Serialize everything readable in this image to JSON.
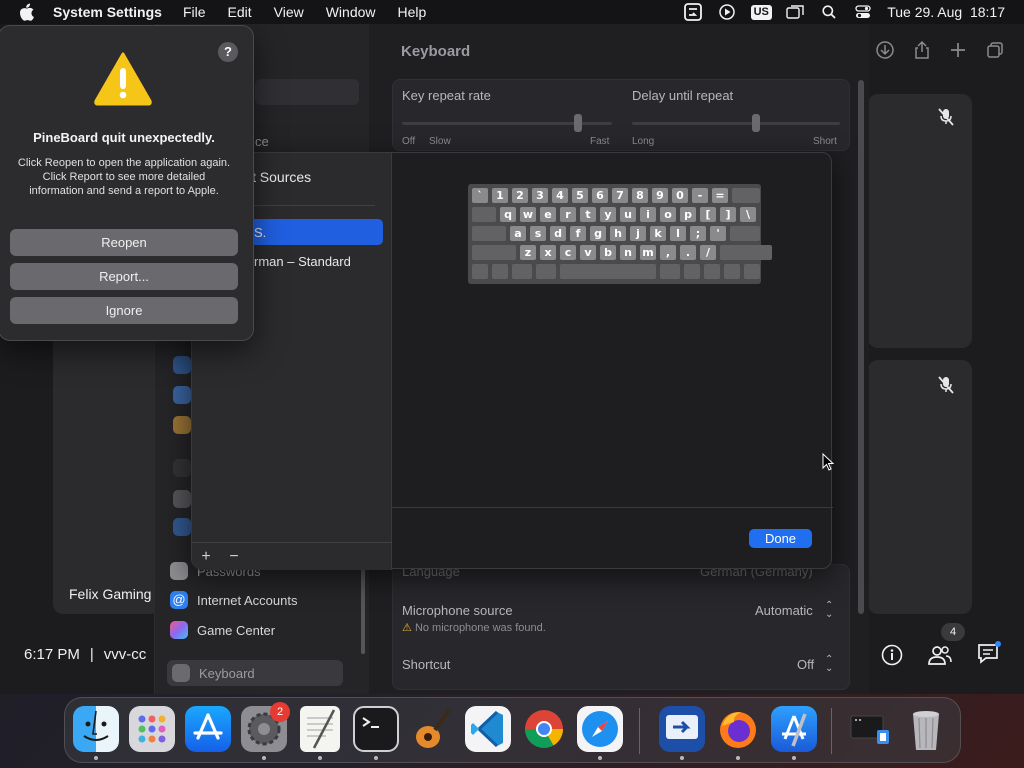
{
  "menubar": {
    "app_name": "System Settings",
    "menus": [
      "File",
      "Edit",
      "View",
      "Window",
      "Help"
    ],
    "input_source": "US",
    "datetime": "Tue 29. Aug  18:17"
  },
  "crash_dialog": {
    "title": "PineBoard quit unexpectedly.",
    "message": "Click Reopen to open the application again. Click Report to see more detailed information and send a report to Apple.",
    "help": "?",
    "buttons": {
      "reopen": "Reopen",
      "report": "Report...",
      "ignore": "Ignore"
    }
  },
  "settings": {
    "page_title": "Keyboard",
    "key_repeat": {
      "label": "Key repeat rate",
      "min": "Off",
      "min2": "Slow",
      "max": "Fast",
      "value": 0.95
    },
    "delay_repeat": {
      "label": "Delay until repeat",
      "min": "Long",
      "max": "Short",
      "value": 0.63
    },
    "sidebar_fragment": "ce",
    "sidebar_items": [
      {
        "label": "Passwords"
      },
      {
        "label": "Internet Accounts"
      },
      {
        "label": "Game Center"
      },
      {
        "label": "Keyboard"
      }
    ],
    "language": {
      "label": "Language",
      "value": "German (Germany)"
    },
    "microphone": {
      "label": "Microphone source",
      "value": "Automatic",
      "warning": "No microphone was found."
    },
    "shortcut": {
      "label": "Shortcut",
      "value": "Off"
    }
  },
  "input_sheet": {
    "header_fragment": "t Sources",
    "sources": [
      {
        "label": "S.",
        "selected": true
      },
      {
        "label": "rman – Standard",
        "selected": false
      }
    ],
    "add": "+",
    "remove": "−",
    "done": "Done",
    "keyboard_rows": [
      [
        "`",
        "1",
        "2",
        "3",
        "4",
        "5",
        "6",
        "7",
        "8",
        "9",
        "0",
        "-",
        "="
      ],
      [
        "q",
        "w",
        "e",
        "r",
        "t",
        "y",
        "u",
        "i",
        "o",
        "p",
        "[",
        "]",
        "\\"
      ],
      [
        "a",
        "s",
        "d",
        "f",
        "g",
        "h",
        "j",
        "k",
        "l",
        ";",
        "'"
      ],
      [
        "z",
        "x",
        "c",
        "v",
        "b",
        "n",
        "m",
        ",",
        ".",
        "/"
      ]
    ]
  },
  "facetime": {
    "caller_name": "Felix Gaming",
    "time": "6:17 PM",
    "call_id_fragment": "vvv-cc",
    "participants_count": "4"
  },
  "dock": {
    "items": [
      "Finder",
      "Launchpad",
      "App Store",
      "System Settings",
      "TextEdit",
      "Terminal",
      "GarageBand",
      "Visual Studio Code",
      "Google Chrome",
      "Safari",
      "Screen Sharing",
      "Firefox",
      "Xcode Instruments",
      "Downloads",
      "Trash"
    ],
    "settings_badge": "2"
  }
}
